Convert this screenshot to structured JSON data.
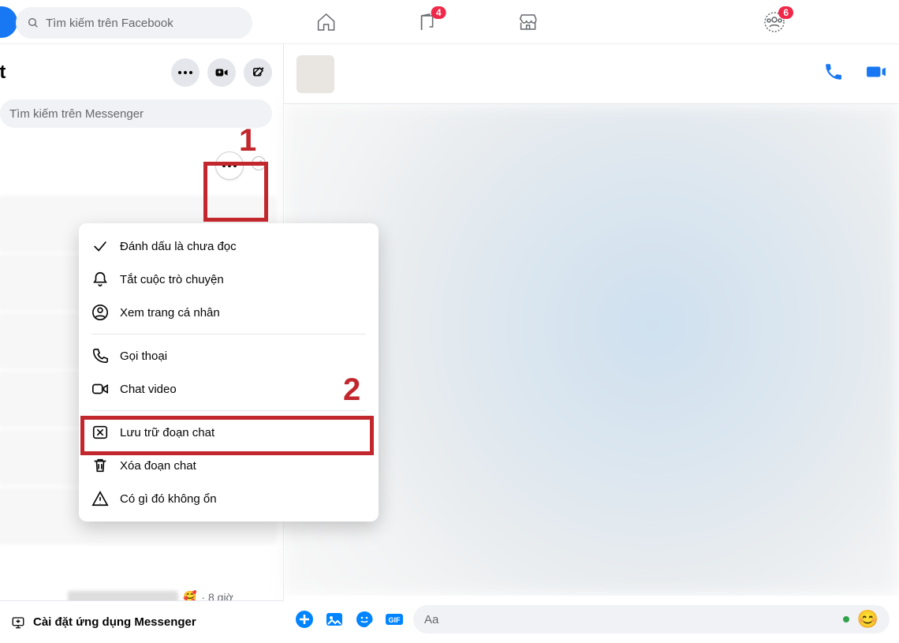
{
  "topbar": {
    "search_placeholder": "Tìm kiếm trên Facebook",
    "pages_badge": "4",
    "groups_badge": "6"
  },
  "sidebar": {
    "title": "at",
    "messenger_search_placeholder": "Tìm kiếm trên Messenger",
    "install_label": "Cài đặt ứng dụng Messenger",
    "snippet_time": "· 8 giờ"
  },
  "menu": {
    "mark_unread": "Đánh dấu là chưa đọc",
    "mute": "Tắt cuộc trò chuyện",
    "view_profile": "Xem trang cá nhân",
    "voice_call": "Gọi thoại",
    "video_chat": "Chat video",
    "archive": "Lưu trữ đoạn chat",
    "delete": "Xóa đoạn chat",
    "report": "Có gì đó không ổn"
  },
  "composer": {
    "placeholder": "Aa"
  },
  "annotations": {
    "n1": "1",
    "n2": "2"
  }
}
